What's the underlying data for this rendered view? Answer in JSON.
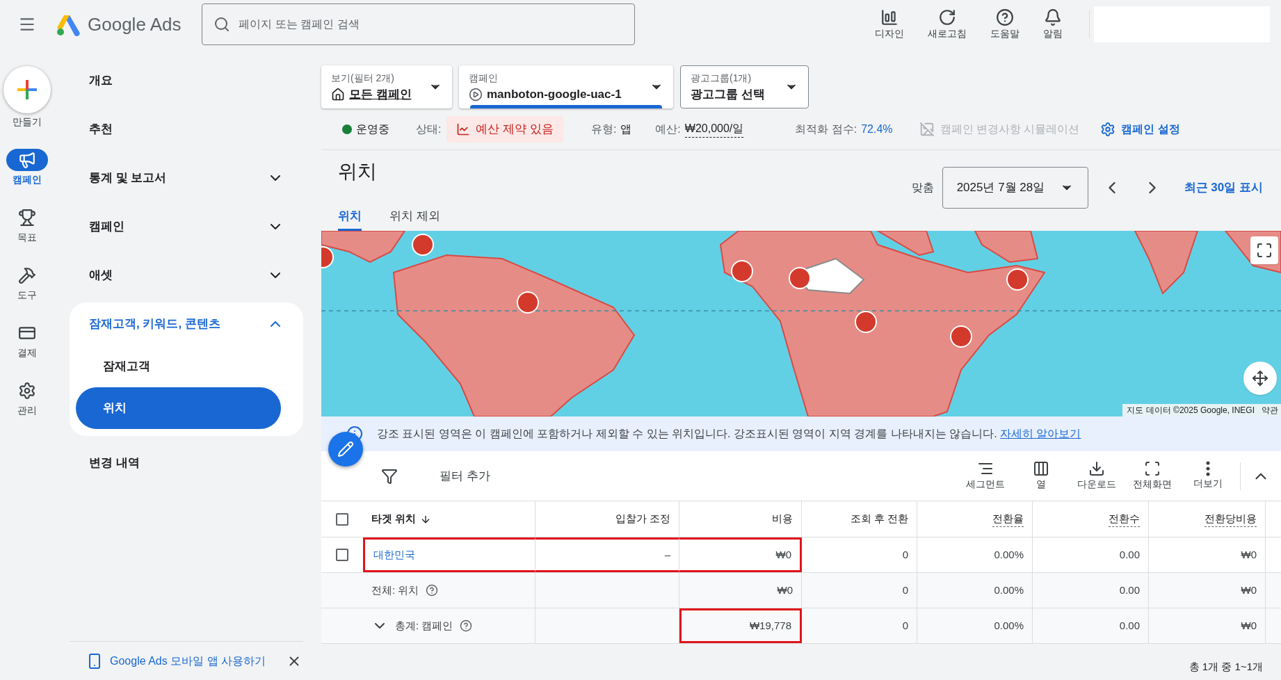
{
  "header": {
    "product_name": "Google Ads",
    "search": {
      "placeholder": "페이지 또는 캠페인 검색"
    },
    "actions": [
      {
        "label": "디자인",
        "kind": "design"
      },
      {
        "label": "새로고침",
        "kind": "refresh"
      },
      {
        "label": "도움말",
        "kind": "help"
      },
      {
        "label": "알림",
        "kind": "bell"
      }
    ]
  },
  "create_button": {
    "label": "만들기"
  },
  "rail": [
    {
      "label": "캠페인",
      "kind": "campaign",
      "selected": true
    },
    {
      "label": "목표",
      "kind": "goal",
      "selected": false
    },
    {
      "label": "도구",
      "kind": "tools",
      "selected": false
    },
    {
      "label": "결제",
      "kind": "billing",
      "selected": false
    },
    {
      "label": "관리",
      "kind": "admin",
      "selected": false
    }
  ],
  "nav": [
    {
      "label": "개요"
    },
    {
      "label": "추천"
    },
    {
      "label": "통계 및 보고서",
      "expanded": false
    },
    {
      "label": "캠페인",
      "expanded": false
    },
    {
      "label": "애셋",
      "expanded": false
    },
    {
      "label": "잠재고객, 키워드, 콘텐츠",
      "expanded": true,
      "children": [
        {
          "label": "잠재고객",
          "selected": false
        },
        {
          "label": "위치",
          "selected": true
        }
      ]
    },
    {
      "label": "변경 내역"
    }
  ],
  "mobile_banner": {
    "text": "Google Ads 모바일 앱 사용하기"
  },
  "selectors": [
    {
      "label": "보기(필터 2개)",
      "value": "모든 캠페인",
      "kind": "view",
      "active": false
    },
    {
      "label": "캠페인",
      "value": "manboton-google-uac-1",
      "kind": "campaign",
      "active": true
    },
    {
      "label": "광고그룹(1개)",
      "value": "광고그룹 선택",
      "kind": "adgroup",
      "active": false
    }
  ],
  "status": {
    "state": "운영중",
    "status_label": "상태:",
    "status_badge": "예산 제약 있음",
    "type_label": "유형:",
    "type_value": "앱",
    "budget_label": "예산:",
    "budget_value": "₩20,000/일",
    "score_label": "최적화 점수:",
    "score_value": "72.4%",
    "simulate": {
      "label": "캠페인 변경사항 시뮬레이션",
      "disabled": true
    },
    "settings": "캠페인 설정"
  },
  "page_title": "위치",
  "date": {
    "label": "맞춤",
    "value": "2025년 7월 28일",
    "range_link": "최근 30일 표시"
  },
  "tabs": [
    {
      "label": "위치",
      "selected": true
    },
    {
      "label": "위치 제외",
      "selected": false
    }
  ],
  "map": {
    "attribution": "지도 데이터 ©2025 Google, INEGI",
    "terms": "약관"
  },
  "notice": {
    "text": "강조 표시된 영역은 이 캠페인에 포함하거나 제외할 수 있는 위치입니다. 강조표시된 영역이 지역 경계를 나타내지는 않습니다.",
    "link": "자세히 알아보기"
  },
  "toolbar": {
    "filter": "필터 추가",
    "actions": [
      {
        "label": "세그먼트",
        "kind": "segment"
      },
      {
        "label": "열",
        "kind": "columns"
      },
      {
        "label": "다운로드",
        "kind": "download"
      },
      {
        "label": "전체화면",
        "kind": "fullscreen"
      },
      {
        "label": "더보기",
        "kind": "more"
      }
    ]
  },
  "table": {
    "all_checked": false,
    "columns": [
      {
        "label": "타겟 위치",
        "sorted": true,
        "has_help": false
      },
      {
        "label": "입찰가 조정",
        "sorted": false,
        "has_help": false
      },
      {
        "label": "비용",
        "sorted": false,
        "has_help": false
      },
      {
        "label": "조회 후 전환",
        "sorted": false,
        "has_help": false
      },
      {
        "label": "전환율",
        "sorted": false,
        "has_help": true
      },
      {
        "label": "전환수",
        "sorted": false,
        "has_help": true
      },
      {
        "label": "전환당비용",
        "sorted": false,
        "has_help": true
      }
    ],
    "rows": [
      {
        "kind": "item",
        "checked": false,
        "cells": [
          "대한민국",
          "–",
          "₩0",
          "0",
          "0.00%",
          "0.00",
          "₩0"
        ],
        "marked": [
          true,
          true,
          true,
          false,
          false,
          false,
          false
        ]
      },
      {
        "kind": "subtotal",
        "cells": [
          "전체: 위치",
          null,
          "₩0",
          "0",
          "0.00%",
          "0.00",
          "₩0"
        ]
      },
      {
        "kind": "total",
        "expanded": false,
        "cells": [
          "총계: 캠페인",
          null,
          "₩19,778",
          "0",
          "0.00%",
          "0.00",
          "₩0"
        ],
        "marked": [
          false,
          false,
          true,
          false,
          false,
          false,
          false
        ]
      }
    ]
  },
  "pagination": "총 1개 중 1~1개"
}
